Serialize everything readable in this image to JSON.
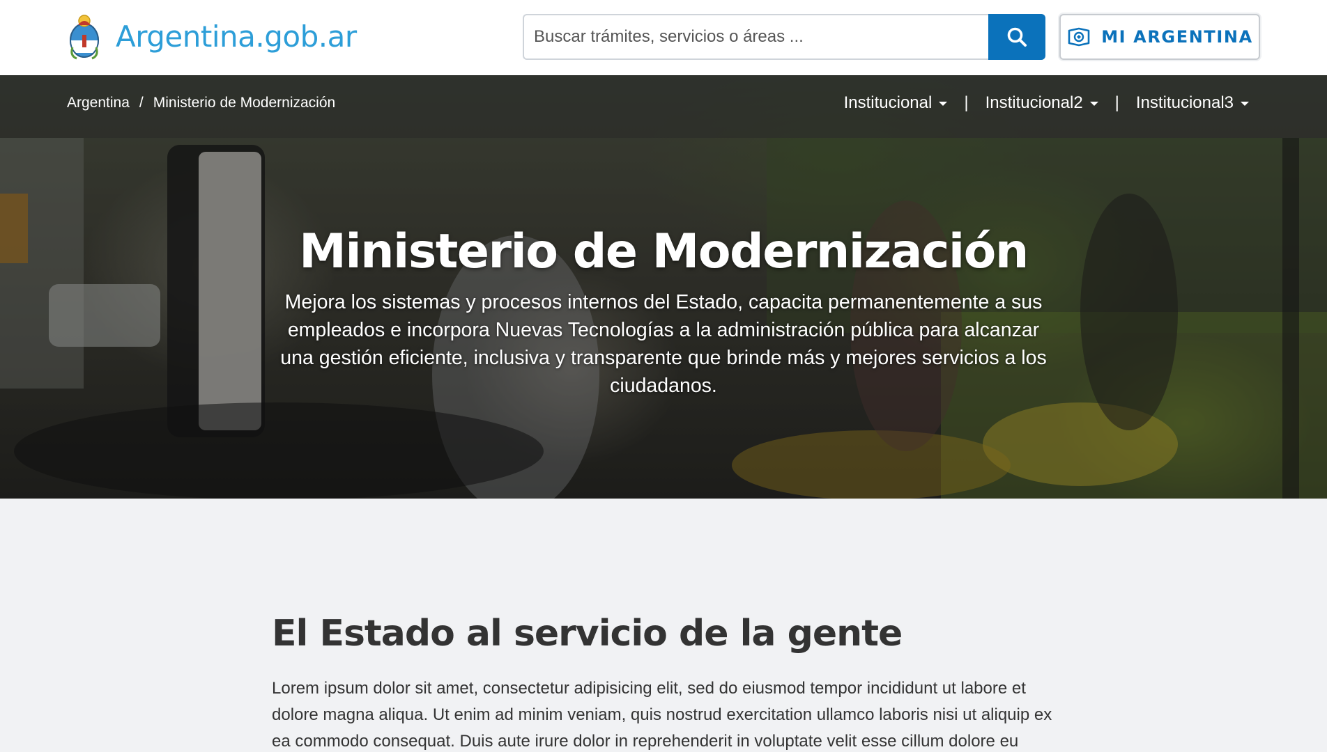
{
  "header": {
    "logo_text": "Argentina.gob.ar",
    "search_placeholder": "Buscar trámites, servicios o áreas ...",
    "mi_argentina_label": "MI ARGENTINA",
    "brand_color": "#2d9ed8",
    "primary_color": "#0b72bb"
  },
  "breadcrumb": {
    "items": [
      "Argentina",
      "Ministerio de Modernización"
    ],
    "separator": "/"
  },
  "nav": {
    "items": [
      {
        "label": "Institucional"
      },
      {
        "label": "Institucional2"
      },
      {
        "label": "Institucional3"
      }
    ],
    "separator": "|"
  },
  "hero": {
    "title": "Ministerio de Modernización",
    "description": "Mejora los sistemas y procesos internos del Estado, capacita permanentemente a sus empleados e incorpora Nuevas Tecnologías a la administración pública para alcanzar una gestión eficiente, inclusiva y transparente que brinde más y mejores servicios a los ciudadanos."
  },
  "section": {
    "title": "El Estado al servicio de la gente",
    "text": "Lorem ipsum dolor sit amet, consectetur adipisicing elit, sed do eiusmod tempor incididunt ut labore et dolore magna aliqua. Ut enim ad minim veniam, quis nostrud exercitation ullamco laboris nisi ut aliquip ex ea commodo consequat. Duis aute irure dolor in reprehenderit in voluptate velit esse cillum dolore eu"
  }
}
